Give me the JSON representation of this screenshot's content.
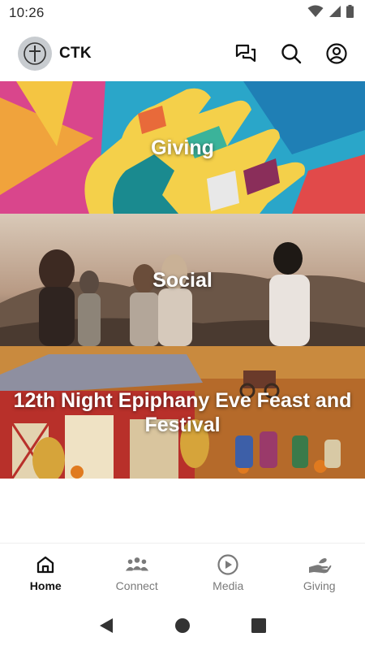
{
  "status_bar": {
    "time": "10:26",
    "icons": [
      "wifi-icon",
      "cell-signal-icon",
      "battery-icon"
    ]
  },
  "header": {
    "app_name": "CTK",
    "logo_icon": "cross-logo-icon",
    "actions": [
      "chat-icon",
      "search-icon",
      "account-icon"
    ]
  },
  "tiles": [
    {
      "title": "Giving",
      "image": "colorful hand mural"
    },
    {
      "title": "Social",
      "image": "friends at sunset"
    },
    {
      "title": "12th Night Epiphany Eve Feast and Festival",
      "image": "folk art harvest festival painting"
    }
  ],
  "bottom_nav": {
    "items": [
      {
        "label": "Home",
        "icon": "home-icon",
        "active": true
      },
      {
        "label": "Connect",
        "icon": "people-group-icon",
        "active": false
      },
      {
        "label": "Media",
        "icon": "play-circle-icon",
        "active": false
      },
      {
        "label": "Giving",
        "icon": "giving-hand-icon",
        "active": false
      }
    ]
  },
  "colors": {
    "accent": "#111111",
    "inactive": "#7a7a7a",
    "logo_bg": "#c8ccd0"
  }
}
